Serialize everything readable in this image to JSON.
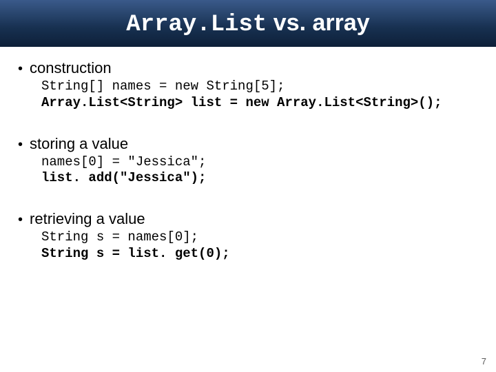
{
  "title": {
    "mono": "Array.List",
    "rest": " vs. array"
  },
  "sections": [
    {
      "label": "construction",
      "lines": [
        {
          "text": "String[] names = new String[5];",
          "bold": false
        },
        {
          "text": "Array.List<String> list = new Array.List<String>();",
          "bold": true
        }
      ]
    },
    {
      "label": "storing a value",
      "lines": [
        {
          "text": "names[0] = \"Jessica\";",
          "bold": false
        },
        {
          "text": "list. add(\"Jessica\");",
          "bold": true
        }
      ]
    },
    {
      "label": "retrieving a value",
      "lines": [
        {
          "text": "String s = names[0];",
          "bold": false
        },
        {
          "text": "String s = list. get(0);",
          "bold": true
        }
      ]
    }
  ],
  "page_number": "7"
}
